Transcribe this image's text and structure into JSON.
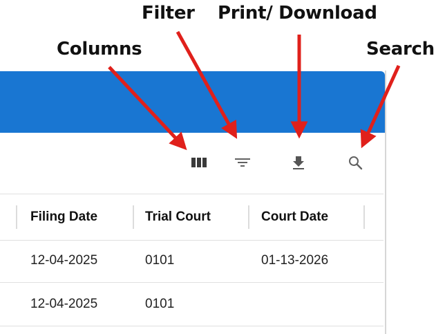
{
  "callouts": {
    "filter": "Filter",
    "print_download": "Print/ Download",
    "columns": "Columns",
    "search": "Search"
  },
  "colors": {
    "appbar": "#1976d2",
    "arrow": "#e0201b",
    "icon": "#616161"
  },
  "toolbar": {
    "icons": [
      "view-column-icon",
      "filter-list-icon",
      "download-icon",
      "search-icon"
    ]
  },
  "table": {
    "columns": [
      "Filing Date",
      "Trial Court",
      "Court Date"
    ],
    "rows": [
      [
        "12-04-2025",
        "0101",
        "01-13-2026"
      ],
      [
        "12-04-2025",
        "0101",
        ""
      ]
    ]
  }
}
